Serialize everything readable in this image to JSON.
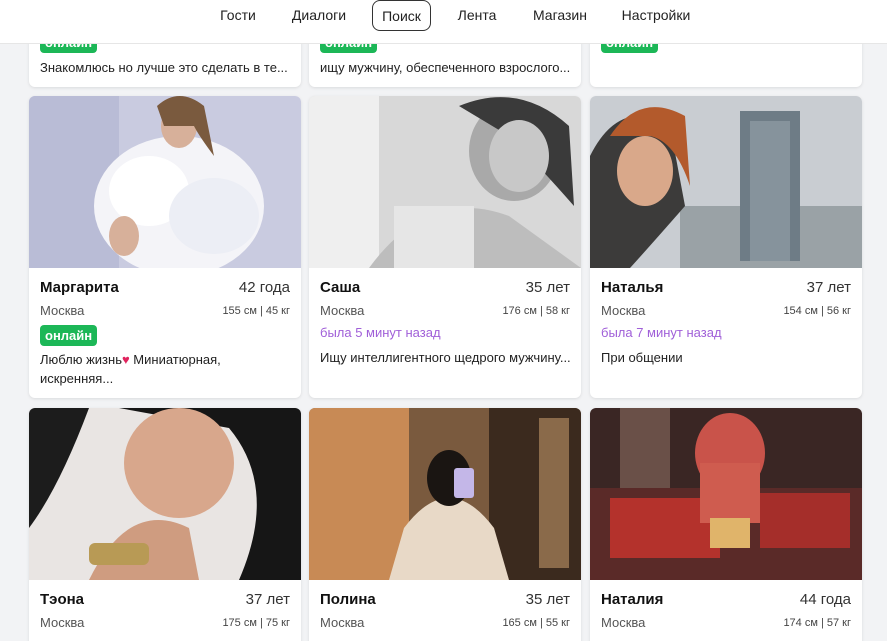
{
  "nav": {
    "items": [
      "Гости",
      "Диалоги",
      "Поиск",
      "Лента",
      "Магазин",
      "Настройки"
    ],
    "active": "Поиск"
  },
  "top_row": [
    {
      "online_label": "онлайн",
      "about": "Знакомлюсь но лучше это сделать в те..."
    },
    {
      "online_label": "онлайн",
      "about": "ищу мужчину, обеспеченного взрослого..."
    },
    {
      "online_label": "онлайн",
      "about": ""
    }
  ],
  "profiles": [
    {
      "name": "Маргарита",
      "age": "42 года",
      "city": "Москва",
      "hw": "155 см | 45 кг",
      "online_label": "онлайн",
      "about_a": "Люблю жизнь",
      "about_icon": "heart-icon",
      "about_b": " Миниатюрная, искренняя..."
    },
    {
      "name": "Саша",
      "age": "35 лет",
      "city": "Москва",
      "hw": "176 см | 58 кг",
      "seen": "была 5 минут назад",
      "about": "Ищу интеллигентного щедрого мужчину..."
    },
    {
      "name": "Наталья",
      "age": "37 лет",
      "city": "Москва",
      "hw": "154 см | 56 кг",
      "seen": "была 7 минут назад",
      "about": "При общении"
    },
    {
      "name": "Тэона",
      "age": "37 лет",
      "city": "Москва",
      "hw": "175 см | 75 кг"
    },
    {
      "name": "Полина",
      "age": "35 лет",
      "city": "Москва",
      "hw": "165 см | 55 кг"
    },
    {
      "name": "Наталия",
      "age": "44 года",
      "city": "Москва",
      "hw": "174 см | 57 кг"
    }
  ],
  "colors": {
    "online": "#1cb757",
    "seen": "#a05fd8",
    "heart": "#e0245e"
  }
}
